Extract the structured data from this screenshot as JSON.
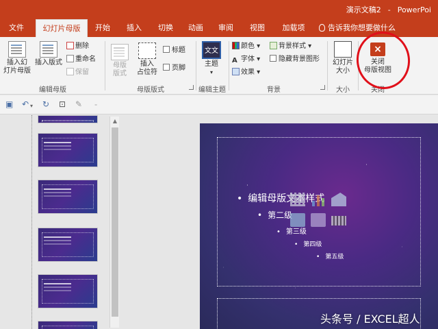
{
  "window": {
    "doc_title": "演示文稿2",
    "separator": "-",
    "app_name": "PowerPoi"
  },
  "tabs": [
    {
      "label": "文件"
    },
    {
      "label": "幻灯片母版"
    },
    {
      "label": "开始"
    },
    {
      "label": "插入"
    },
    {
      "label": "切换"
    },
    {
      "label": "动画"
    },
    {
      "label": "审阅"
    },
    {
      "label": "视图"
    },
    {
      "label": "加载项"
    }
  ],
  "tell_me": "告诉我你想要做什么",
  "ribbon": {
    "edit_master": {
      "insert_slide_master": "插入幻\n灯片母版",
      "insert_layout": "插入版式",
      "delete": "删除",
      "rename": "重命名",
      "preserve": "保留",
      "label": "编辑母版"
    },
    "master_layout": {
      "master_layout": "母版\n版式",
      "insert_placeholder": "插入\n占位符",
      "title": "标题",
      "footers": "页脚",
      "label": "母版版式"
    },
    "edit_theme": {
      "themes": "主题",
      "theme_icon_text": "文文",
      "label": "编辑主题"
    },
    "background": {
      "colors": "颜色",
      "fonts": "字体",
      "effects": "效果",
      "background_styles": "背景样式",
      "hide_background_graphics": "隐藏背景图形",
      "label": "背景"
    },
    "size": {
      "slide_size": "幻灯片\n大小",
      "label": "大小"
    },
    "close": {
      "close_master_view": "关闭\n母版视图",
      "label": "关闭",
      "icon": "×"
    }
  },
  "qat": {
    "icons": [
      "save-icon",
      "undo-icon",
      "redo-icon",
      "present-icon",
      "touch-mode-icon",
      "customize-icon"
    ]
  },
  "thumbnails": {
    "numbers": [
      "",
      "",
      "",
      "",
      "",
      ""
    ]
  },
  "slide": {
    "level1": "编辑母版文本样式",
    "level2": "第二级",
    "level3": "第三级",
    "level4": "第四级",
    "level5": "第五级",
    "bullet": "•"
  },
  "watermark": "头条号 / EXCEL超人",
  "colors": {
    "accent": "#c43e1c",
    "ribbon_bg": "#f3f3f3",
    "annotation": "#e0101a"
  }
}
